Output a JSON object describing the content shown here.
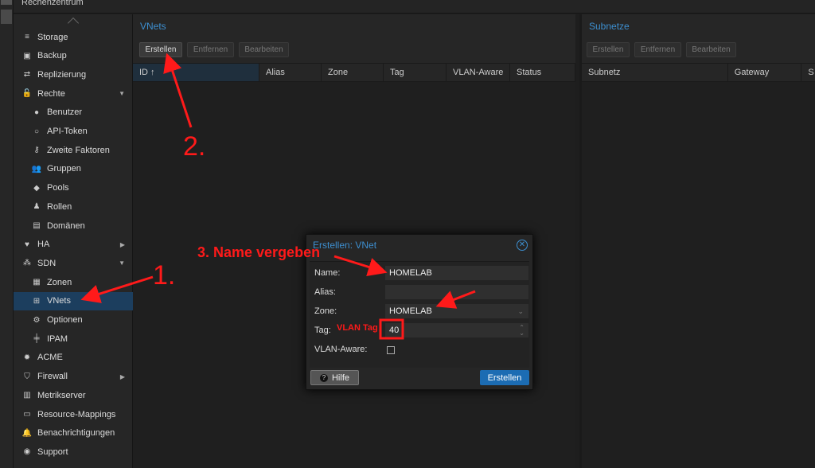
{
  "topbar": {
    "title": "Rechenzentrum"
  },
  "sidebar": {
    "items": [
      {
        "label": "Storage",
        "icon": "database-icon",
        "glyph": "≡"
      },
      {
        "label": "Backup",
        "icon": "floppy-icon",
        "glyph": "▣"
      },
      {
        "label": "Replizierung",
        "icon": "retweet-icon",
        "glyph": "⇄"
      },
      {
        "label": "Rechte",
        "icon": "unlock-icon",
        "glyph": "🔓",
        "expand": "▼"
      },
      {
        "label": "Benutzer",
        "icon": "user-icon",
        "glyph": "●",
        "indent": true
      },
      {
        "label": "API-Token",
        "icon": "user-outline-icon",
        "glyph": "○",
        "indent": true
      },
      {
        "label": "Zweite Faktoren",
        "icon": "key-icon",
        "glyph": "⚷",
        "indent": true
      },
      {
        "label": "Gruppen",
        "icon": "users-icon",
        "glyph": "👥",
        "indent": true
      },
      {
        "label": "Pools",
        "icon": "tags-icon",
        "glyph": "◆",
        "indent": true
      },
      {
        "label": "Rollen",
        "icon": "male-icon",
        "glyph": "♟",
        "indent": true
      },
      {
        "label": "Domänen",
        "icon": "address-book-icon",
        "glyph": "▤",
        "indent": true
      },
      {
        "label": "HA",
        "icon": "heartbeat-icon",
        "glyph": "♥",
        "expand": "▶"
      },
      {
        "label": "SDN",
        "icon": "sdn-icon",
        "glyph": "⁂",
        "expand": "▼"
      },
      {
        "label": "Zonen",
        "icon": "th-icon",
        "glyph": "▦",
        "indent": true
      },
      {
        "label": "VNets",
        "icon": "sitemap-icon",
        "glyph": "⊞",
        "indent": true,
        "selected": true
      },
      {
        "label": "Optionen",
        "icon": "gear-icon",
        "glyph": "⚙",
        "indent": true
      },
      {
        "label": "IPAM",
        "icon": "ipam-icon",
        "glyph": "╪",
        "indent": true
      },
      {
        "label": "ACME",
        "icon": "certificate-icon",
        "glyph": "✹"
      },
      {
        "label": "Firewall",
        "icon": "shield-icon",
        "glyph": "⛉",
        "expand": "▶"
      },
      {
        "label": "Metrikserver",
        "icon": "bar-chart-icon",
        "glyph": "▥"
      },
      {
        "label": "Resource-Mappings",
        "icon": "folder-icon",
        "glyph": "▭"
      },
      {
        "label": "Benachrichtigungen",
        "icon": "bell-icon",
        "glyph": "🔔"
      },
      {
        "label": "Support",
        "icon": "comments-icon",
        "glyph": "◉"
      }
    ]
  },
  "vnets": {
    "title": "VNets",
    "buttons": [
      "Erstellen",
      "Entfernen",
      "Bearbeiten"
    ],
    "columns": [
      "ID ↑",
      "Alias",
      "Zone",
      "Tag",
      "VLAN-Aware",
      "Status"
    ]
  },
  "subnets": {
    "title": "Subnetze",
    "buttons": [
      "Erstellen",
      "Entfernen",
      "Bearbeiten"
    ],
    "columns": [
      "Subnetz",
      "Gateway",
      "S"
    ]
  },
  "dialog": {
    "title": "Erstellen: VNet",
    "fields": {
      "name_label": "Name:",
      "name_value": "HOMELAB",
      "alias_label": "Alias:",
      "alias_value": "",
      "zone_label": "Zone:",
      "zone_value": "HOMELAB",
      "tag_label": "Tag:",
      "tag_value": "40",
      "vlan_aware_label": "VLAN-Aware:",
      "vlan_aware_checked": false
    },
    "help_label": "Hilfe",
    "submit_label": "Erstellen"
  },
  "annotations": {
    "step1": "1.",
    "step2": "2.",
    "step3": "3. Name vergeben",
    "vlan_tag": "VLAN Tag",
    "color": "#ff1a1a"
  },
  "colors": {
    "accent": "#3d8fd0",
    "primary_button": "#1c6cb3",
    "selected": "#1c3e5e"
  }
}
